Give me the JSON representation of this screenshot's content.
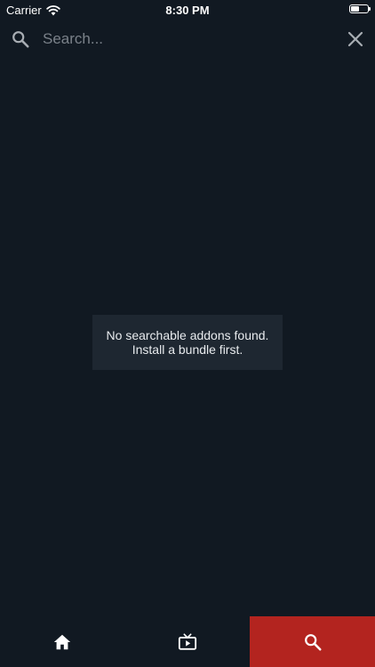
{
  "status_bar": {
    "carrier": "Carrier",
    "time": "8:30 PM"
  },
  "search": {
    "placeholder": "Search...",
    "value": "",
    "icon": "search-icon",
    "clear_icon": "close-icon"
  },
  "message": {
    "line1": "No searchable addons found.",
    "line2": "Install a bundle first."
  },
  "tabs": [
    {
      "icon": "home-icon",
      "active": false
    },
    {
      "icon": "tv-play-icon",
      "active": false
    },
    {
      "icon": "search-icon",
      "active": true
    }
  ],
  "colors": {
    "background": "#111922",
    "message_background": "#1e2731",
    "active_tab": "#b3241f",
    "placeholder": "#7a8189"
  }
}
